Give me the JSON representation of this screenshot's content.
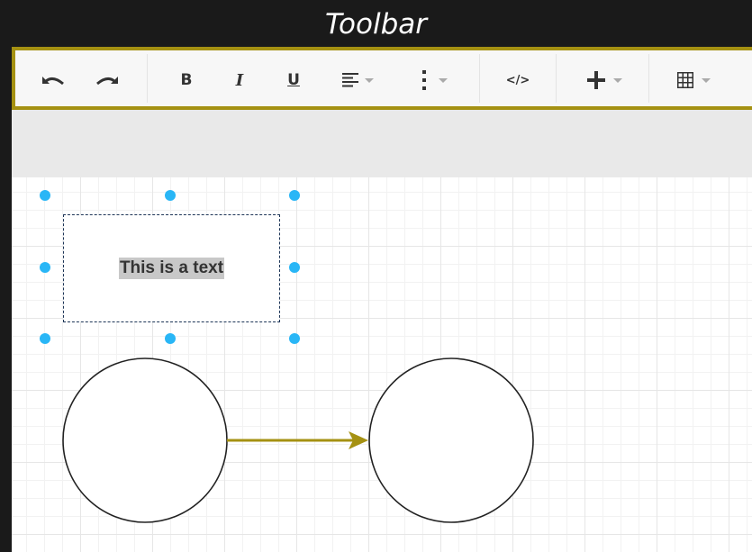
{
  "caption": "Toolbar",
  "toolbar": {
    "undo": "undo-icon",
    "redo": "redo-icon",
    "bold_label": "B",
    "italic_label": "I",
    "underline_label": "U",
    "align": "align-left-icon",
    "more": "more-vertical-icon",
    "code_label": "</>",
    "insert": "plus-icon",
    "table": "table-icon"
  },
  "canvas": {
    "text_label": "This is a text",
    "shapes": [
      "circle",
      "circle"
    ],
    "connector": "arrow"
  },
  "colors": {
    "accent": "#a59112",
    "selection_handle": "#29b6f6",
    "text_highlight": "#c8c8c8"
  }
}
